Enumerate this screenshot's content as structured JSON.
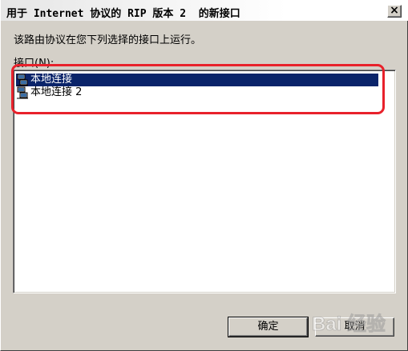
{
  "window": {
    "title": "用于 Internet 协议的 RIP 版本 2  的新接口",
    "close_glyph": "×"
  },
  "dialog": {
    "description": "该路由协议在您下列选择的接口上运行。",
    "list_label": "接口(N):",
    "interfaces": [
      {
        "label": "本地连接",
        "selected": true,
        "icon": "network-connection-icon"
      },
      {
        "label": "本地连接 2",
        "selected": false,
        "icon": "network-connection-icon"
      }
    ]
  },
  "buttons": {
    "ok_label": "确定",
    "cancel_label": "取消"
  },
  "watermark": {
    "text": "Bai 经验"
  },
  "colors": {
    "dialog_face": "#d4d0c8",
    "selection": "#0a246a",
    "annotation_ring": "#e8212b"
  }
}
